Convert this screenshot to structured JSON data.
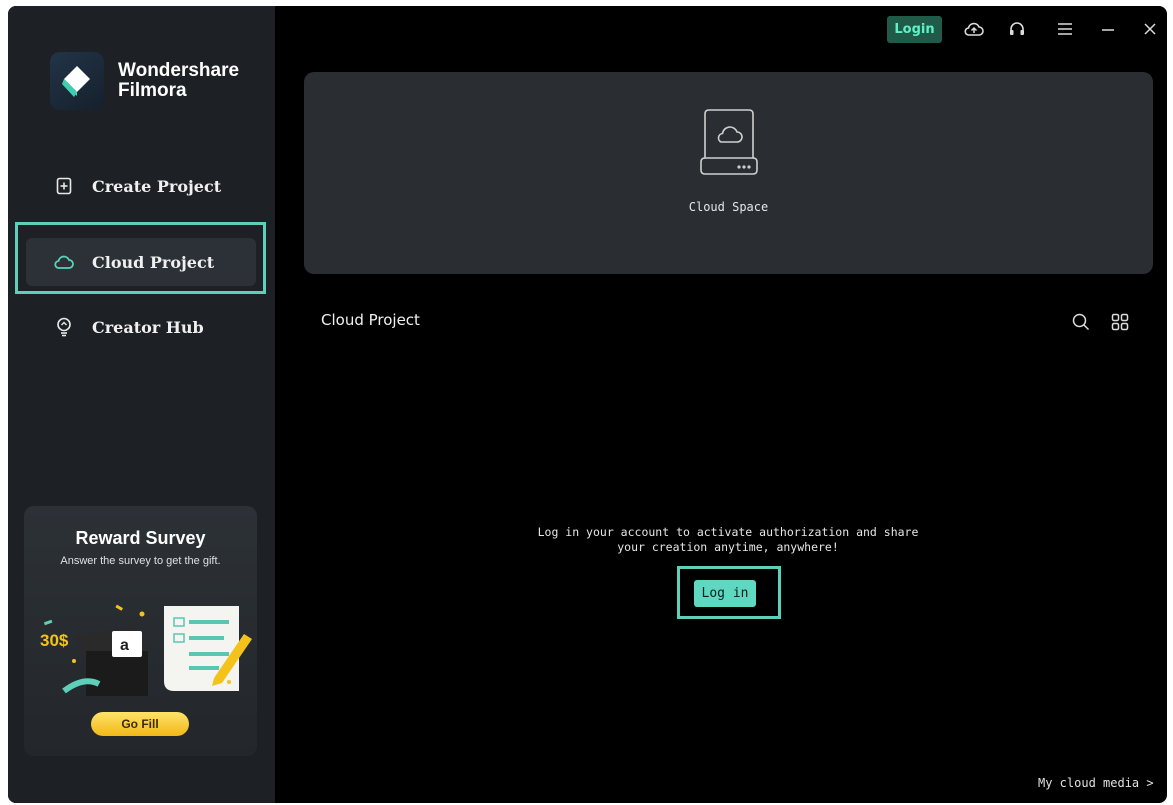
{
  "brand": {
    "line1": "Wondershare",
    "line2": "Filmora"
  },
  "sidebar": {
    "items": [
      {
        "label": "Create Project",
        "icon": "add-file-icon"
      },
      {
        "label": "Cloud Project",
        "icon": "cloud-icon",
        "active": true
      },
      {
        "label": "Creator Hub",
        "icon": "lightbulb-icon"
      }
    ]
  },
  "reward": {
    "title": "Reward Survey",
    "subtitle": "Answer the survey to get the gift.",
    "badge": "30$",
    "button": "Go Fill"
  },
  "topbar": {
    "login_label": "Login",
    "icons": [
      "cloud-upload-icon",
      "headset-icon",
      "menu-icon",
      "minimize-icon",
      "close-icon"
    ]
  },
  "cloud_space": {
    "label": "Cloud Space"
  },
  "main": {
    "section_title": "Cloud Project",
    "message_line1": "Log in your account to activate authorization and share",
    "message_line2": "your creation anytime, anywhere!",
    "login_button": "Log in",
    "my_cloud_media": "My cloud media >"
  },
  "colors": {
    "accent": "#5ecfb9",
    "sidebar_bg": "#1d2126",
    "main_bg": "#000000",
    "coupon_yellow": "#f5c21b"
  }
}
